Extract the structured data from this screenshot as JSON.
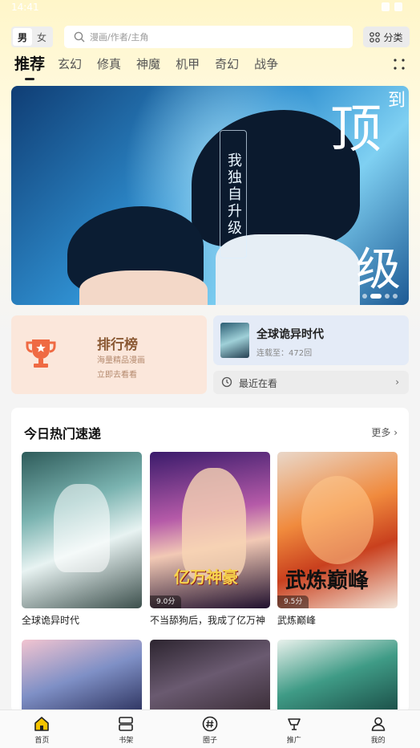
{
  "status": {
    "time": "14:41"
  },
  "header": {
    "gender": {
      "male": "男",
      "female": "女"
    },
    "search": {
      "placeholder": "漫画/作者/主角"
    },
    "category_label": "分类"
  },
  "tabs": [
    {
      "label": "推荐"
    },
    {
      "label": "玄幻"
    },
    {
      "label": "修真"
    },
    {
      "label": "神魔"
    },
    {
      "label": "机甲"
    },
    {
      "label": "奇幻"
    },
    {
      "label": "战争"
    }
  ],
  "banner": {
    "vertical_title": "我独自升级",
    "big_char_top": "顶",
    "big_char_bottom": "级",
    "small_char": "到",
    "indicator_count": 4
  },
  "rank": {
    "title": "排行榜",
    "line1": "海量精品漫画",
    "line2": "立即去看看"
  },
  "continue_reading": {
    "title": "全球诡异时代",
    "subtitle": "连载至：472回"
  },
  "recent": {
    "label": "最近在看"
  },
  "hot": {
    "title": "今日热门速递",
    "more": "更多",
    "items": [
      {
        "name": "全球诡异时代",
        "score": ""
      },
      {
        "name": "不当舔狗后，我成了亿万神",
        "score": "9.0分",
        "logo": "亿万神豪"
      },
      {
        "name": "武炼巅峰",
        "score": "9.5分",
        "logo": "武炼巅峰"
      }
    ]
  },
  "bottom_nav": [
    {
      "label": "首页",
      "icon": "home-icon"
    },
    {
      "label": "书架",
      "icon": "bookshelf-icon"
    },
    {
      "label": "圈子",
      "icon": "hashtag-icon"
    },
    {
      "label": "推广",
      "icon": "promote-icon"
    },
    {
      "label": "我的",
      "icon": "profile-icon"
    }
  ],
  "colors": {
    "accent": "#f5c400",
    "rank_bg": "#fbe7db",
    "rank_text": "#8b5a34",
    "continue_bg": "#e4ebf7"
  }
}
